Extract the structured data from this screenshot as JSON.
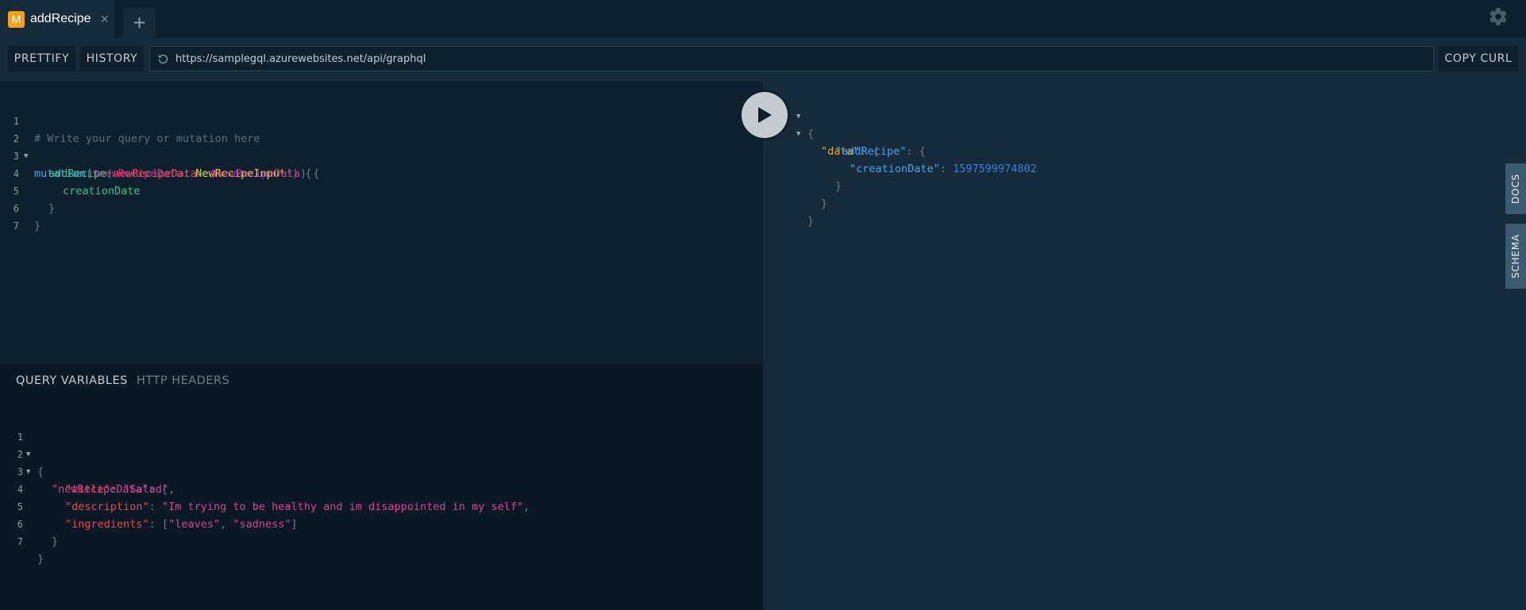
{
  "tabs": [
    {
      "badge": "M",
      "title": "addRecipe",
      "close_icon": "close-icon"
    }
  ],
  "add_tab_label": "+",
  "toolbar": {
    "prettify_label": "PRETTIFY",
    "history_label": "HISTORY",
    "url": "https://samplegql.azurewebsites.net/api/graphql",
    "copy_curl_label": "COPY CURL"
  },
  "editor": {
    "line_numbers": [
      "1",
      "2",
      "3",
      "4",
      "5",
      "6",
      "7"
    ],
    "lines": [
      {
        "comment": "# Write your query or mutation here"
      },
      {
        "kw": "mutation",
        "p1": "(",
        "var": "$newRecipeData",
        "p2": ": ",
        "type": "NewRecipeInput",
        "p3": "!) {"
      },
      {
        "field": "addRecipe",
        "p1": "(",
        "arg": "newRecipeData",
        "p2": ": ",
        "var": "$newRecipeData",
        "p3": ") {"
      },
      {
        "field": "creationDate"
      },
      {
        "p1": "}"
      },
      {
        "p1": "}"
      },
      {
        "p1": ""
      }
    ]
  },
  "variables": {
    "tabs": [
      "QUERY VARIABLES",
      "HTTP HEADERS"
    ],
    "line_numbers": [
      "1",
      "2",
      "3",
      "4",
      "5",
      "6",
      "7"
    ],
    "lines": [
      {
        "p1": "{"
      },
      {
        "key": "\"newRecipeData\"",
        "p1": ": {"
      },
      {
        "key": "\"title\"",
        "p1": ": ",
        "str": "\"Salad\"",
        "p2": ","
      },
      {
        "key": "\"description\"",
        "p1": ": ",
        "str": "\"Im trying to be healthy and im disappointed in my self\"",
        "p2": ","
      },
      {
        "key": "\"ingredients\"",
        "p1": ": [",
        "str": "\"leaves\"",
        "p2": ", ",
        "str2": "\"sadness\"",
        "p3": "]"
      },
      {
        "p1": "}"
      },
      {
        "p1": "}"
      }
    ]
  },
  "result": {
    "lines": [
      {
        "p1": "{"
      },
      {
        "key": "\"data\"",
        "p1": ": {"
      },
      {
        "key": "\"addRecipe\"",
        "p1": ": {"
      },
      {
        "key": "\"creationDate\"",
        "p1": ": ",
        "num": "1597599974802"
      },
      {
        "p1": "}"
      },
      {
        "p1": "}"
      },
      {
        "p1": "}"
      }
    ]
  },
  "side_tabs": {
    "docs": "DOCS",
    "schema": "SCHEMA"
  },
  "icons": {
    "settings": "gear-icon",
    "play": "play-icon",
    "url_reload": "reload-icon"
  },
  "colors": {
    "accent": "#f1a219",
    "background": "#172a3a"
  }
}
